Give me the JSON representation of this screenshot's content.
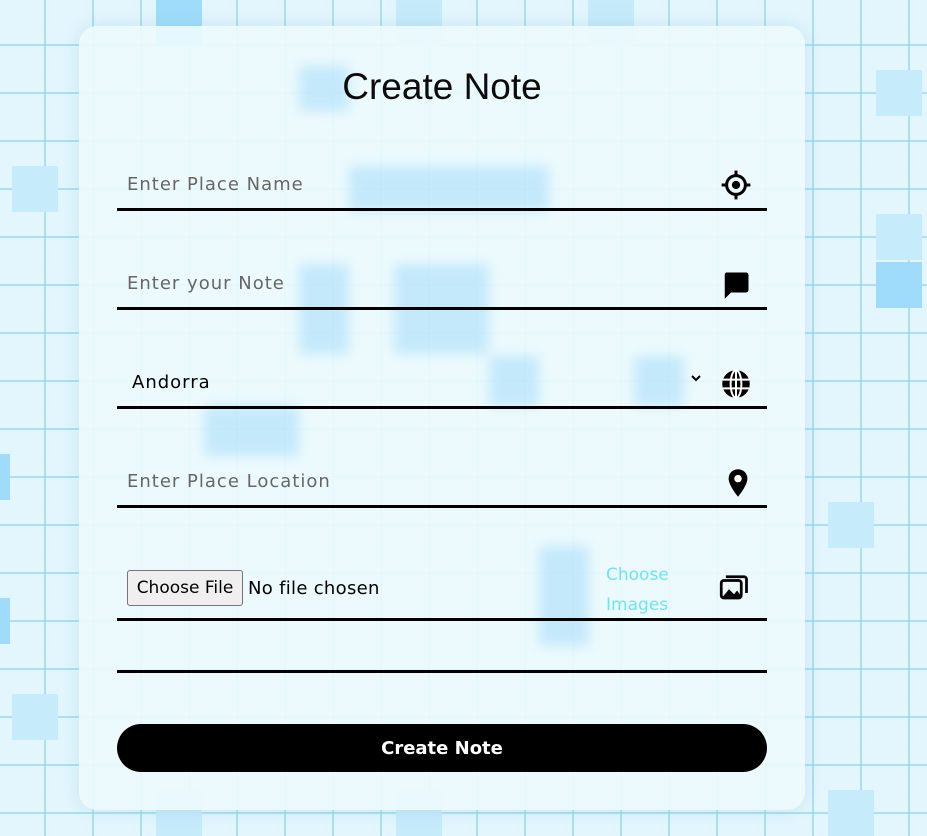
{
  "form": {
    "title": "Create Note",
    "place_name": {
      "placeholder": "Enter Place Name",
      "value": "",
      "icon": "crosshair-icon"
    },
    "note": {
      "placeholder": "Enter your Note",
      "value": "",
      "icon": "comment-icon"
    },
    "country": {
      "selected": "Andorra",
      "icon": "globe-icon"
    },
    "location": {
      "placeholder": "Enter Place Location",
      "value": "",
      "icon": "map-pin-icon"
    },
    "images": {
      "button_label": "Choose File",
      "status": "No file chosen",
      "label": "Choose Images",
      "icon": "images-icon"
    },
    "submit_label": "Create Note"
  },
  "colors": {
    "accent": "#000000",
    "choose_images_label": "#6de3f5",
    "background": "#e3f6fd",
    "card": "#ecfbfd",
    "tile": "#9fdcfb"
  }
}
